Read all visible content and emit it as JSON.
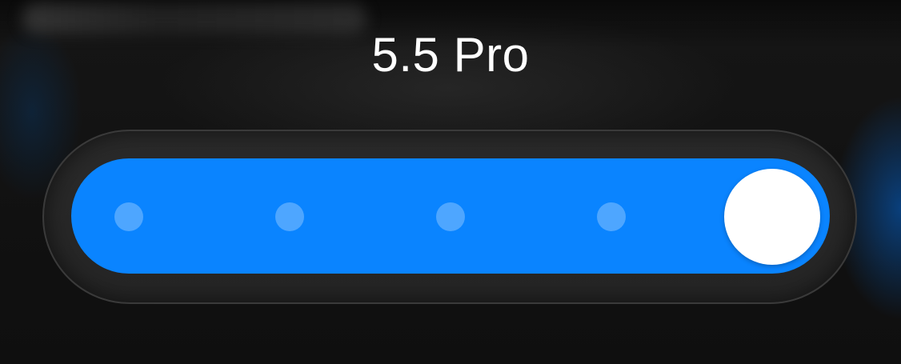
{
  "model_picker": {
    "title": "5.5 Pro",
    "slider": {
      "step_count": 5,
      "selected_step": 5,
      "accent_color": "#0a84ff",
      "knob_color": "#ffffff"
    }
  }
}
